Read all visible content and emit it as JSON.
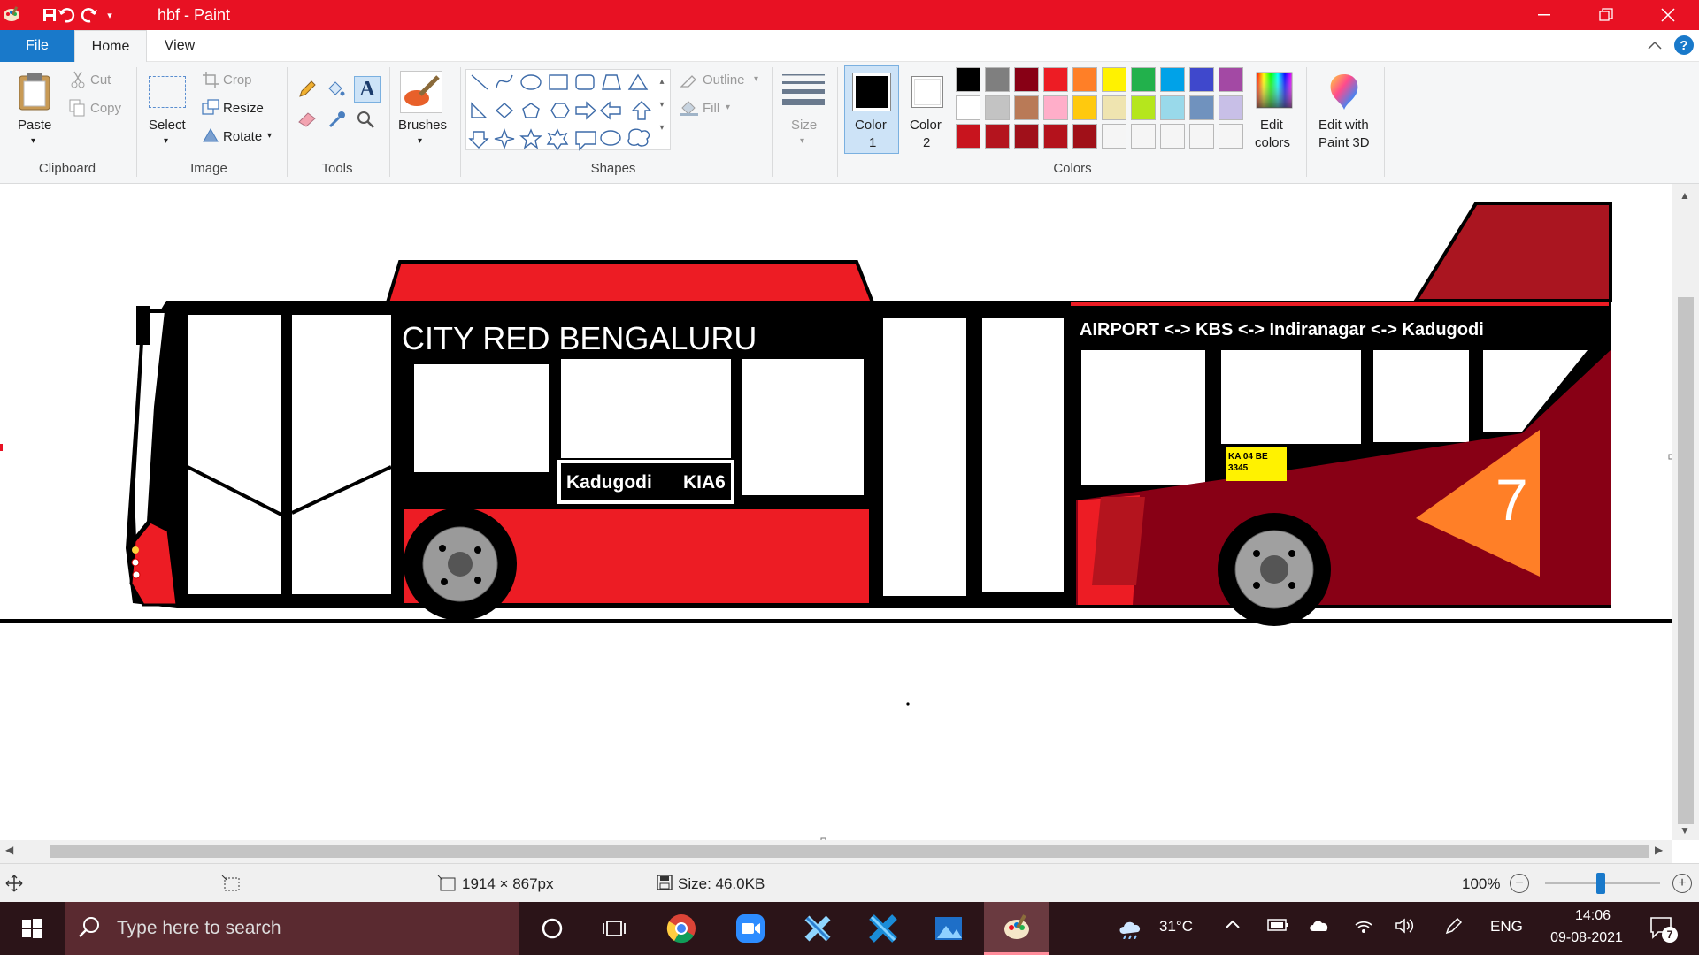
{
  "window": {
    "title": "hbf - Paint",
    "minimize_icon": "minimize-icon",
    "maximize_icon": "restore-icon",
    "close_icon": "close-icon"
  },
  "tabs": [
    {
      "label": "File"
    },
    {
      "label": "Home"
    },
    {
      "label": "View"
    }
  ],
  "ribbon": {
    "clipboard": {
      "paste": "Paste",
      "cut": "Cut",
      "copy": "Copy",
      "group": "Clipboard"
    },
    "image": {
      "select": "Select",
      "crop": "Crop",
      "resize": "Resize",
      "rotate": "Rotate",
      "group": "Image"
    },
    "tools": {
      "group": "Tools"
    },
    "brushes": {
      "label": "Brushes"
    },
    "shapes": {
      "outline": "Outline",
      "fill": "Fill",
      "group": "Shapes"
    },
    "size": {
      "label": "Size"
    },
    "color1": {
      "label": "Color",
      "num": "1",
      "value": "#000000"
    },
    "color2": {
      "label": "Color",
      "num": "2",
      "value": "#ffffff"
    },
    "colors_group": "Colors",
    "edit_colors": {
      "line1": "Edit",
      "line2": "colors"
    },
    "paint3d": {
      "line1": "Edit with",
      "line2": "Paint 3D"
    },
    "palette_row1": [
      "#000000",
      "#7f7f7f",
      "#880015",
      "#ed1c24",
      "#ff7f27",
      "#fff200",
      "#22b14c",
      "#00a2e8",
      "#3f48cc",
      "#a349a4"
    ],
    "palette_row2": [
      "#ffffff",
      "#c3c3c3",
      "#b97a57",
      "#ffaec9",
      "#ffc90e",
      "#efe4b0",
      "#b5e61d",
      "#99d9ea",
      "#7092be",
      "#c8bfe7"
    ],
    "palette_row3": [
      "#c8141e",
      "#b4141e",
      "#a0101a",
      "#b4121c",
      "#a01018",
      "#f5f5f5",
      "#f5f5f5",
      "#f5f5f5",
      "#f5f5f5",
      "#f5f5f5"
    ]
  },
  "drawing": {
    "brand_text": "CITY RED BENGALURU",
    "route_text": "AIRPORT <-> KBS <-> Indiranagar <-> Kadugodi",
    "destination_left": "Kadugodi",
    "destination_right": "KIA6",
    "plate_line1": "KA  04  BE",
    "plate_line2": "3345",
    "route_number": "7"
  },
  "status": {
    "dimensions": "1914 × 867px",
    "size": "Size: 46.0KB",
    "zoom": "100%"
  },
  "taskbar": {
    "search_placeholder": "Type here to search",
    "weather": "31°C",
    "language": "ENG",
    "time": "14:06",
    "date": "09-08-2021",
    "notifications": "7"
  }
}
